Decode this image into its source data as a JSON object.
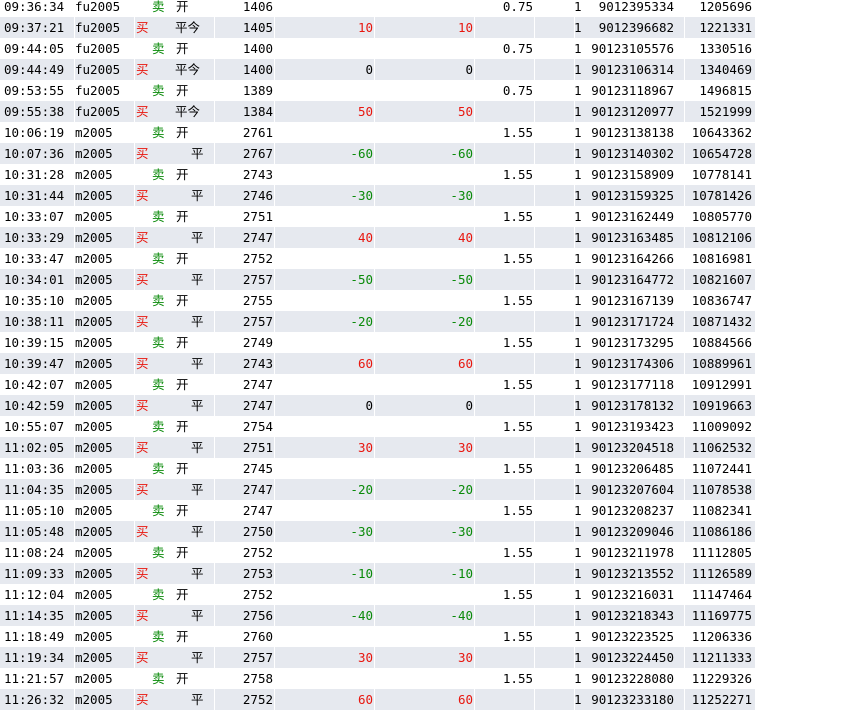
{
  "colors": {
    "buy": "#e8170f",
    "sell": "#0a8a0a",
    "row_alt": "#e6e9ef"
  },
  "rows": [
    {
      "time": "09:36:34",
      "symbol": "fu2005",
      "dir": "卖",
      "dir_type": "sell",
      "offset": "开",
      "offset_type": "open",
      "price": "1406",
      "pnl1": "",
      "pnl2": "",
      "fee": "0.75",
      "one": "1",
      "order_id": "9012395334",
      "trade_id": "1205696"
    },
    {
      "time": "09:37:21",
      "symbol": "fu2005",
      "dir": "买",
      "dir_type": "buy",
      "offset": "平今",
      "offset_type": "close2",
      "price": "1405",
      "pnl1": "10",
      "pnl2": "10",
      "fee": "",
      "one": "1",
      "order_id": "9012396682",
      "trade_id": "1221331"
    },
    {
      "time": "09:44:05",
      "symbol": "fu2005",
      "dir": "卖",
      "dir_type": "sell",
      "offset": "开",
      "offset_type": "open",
      "price": "1400",
      "pnl1": "",
      "pnl2": "",
      "fee": "0.75",
      "one": "1",
      "order_id": "90123105576",
      "trade_id": "1330516"
    },
    {
      "time": "09:44:49",
      "symbol": "fu2005",
      "dir": "买",
      "dir_type": "buy",
      "offset": "平今",
      "offset_type": "close2",
      "price": "1400",
      "pnl1": "0",
      "pnl2": "0",
      "fee": "",
      "one": "1",
      "order_id": "90123106314",
      "trade_id": "1340469"
    },
    {
      "time": "09:53:55",
      "symbol": "fu2005",
      "dir": "卖",
      "dir_type": "sell",
      "offset": "开",
      "offset_type": "open",
      "price": "1389",
      "pnl1": "",
      "pnl2": "",
      "fee": "0.75",
      "one": "1",
      "order_id": "90123118967",
      "trade_id": "1496815"
    },
    {
      "time": "09:55:38",
      "symbol": "fu2005",
      "dir": "买",
      "dir_type": "buy",
      "offset": "平今",
      "offset_type": "close2",
      "price": "1384",
      "pnl1": "50",
      "pnl2": "50",
      "fee": "",
      "one": "1",
      "order_id": "90123120977",
      "trade_id": "1521999"
    },
    {
      "time": "10:06:19",
      "symbol": "m2005",
      "dir": "卖",
      "dir_type": "sell",
      "offset": "开",
      "offset_type": "open",
      "price": "2761",
      "pnl1": "",
      "pnl2": "",
      "fee": "1.55",
      "one": "1",
      "order_id": "90123138138",
      "trade_id": "10643362"
    },
    {
      "time": "10:07:36",
      "symbol": "m2005",
      "dir": "买",
      "dir_type": "buy",
      "offset": "平",
      "offset_type": "close1",
      "price": "2767",
      "pnl1": "-60",
      "pnl2": "-60",
      "fee": "",
      "one": "1",
      "order_id": "90123140302",
      "trade_id": "10654728"
    },
    {
      "time": "10:31:28",
      "symbol": "m2005",
      "dir": "卖",
      "dir_type": "sell",
      "offset": "开",
      "offset_type": "open",
      "price": "2743",
      "pnl1": "",
      "pnl2": "",
      "fee": "1.55",
      "one": "1",
      "order_id": "90123158909",
      "trade_id": "10778141"
    },
    {
      "time": "10:31:44",
      "symbol": "m2005",
      "dir": "买",
      "dir_type": "buy",
      "offset": "平",
      "offset_type": "close1",
      "price": "2746",
      "pnl1": "-30",
      "pnl2": "-30",
      "fee": "",
      "one": "1",
      "order_id": "90123159325",
      "trade_id": "10781426"
    },
    {
      "time": "10:33:07",
      "symbol": "m2005",
      "dir": "卖",
      "dir_type": "sell",
      "offset": "开",
      "offset_type": "open",
      "price": "2751",
      "pnl1": "",
      "pnl2": "",
      "fee": "1.55",
      "one": "1",
      "order_id": "90123162449",
      "trade_id": "10805770"
    },
    {
      "time": "10:33:29",
      "symbol": "m2005",
      "dir": "买",
      "dir_type": "buy",
      "offset": "平",
      "offset_type": "close1",
      "price": "2747",
      "pnl1": "40",
      "pnl2": "40",
      "fee": "",
      "one": "1",
      "order_id": "90123163485",
      "trade_id": "10812106"
    },
    {
      "time": "10:33:47",
      "symbol": "m2005",
      "dir": "卖",
      "dir_type": "sell",
      "offset": "开",
      "offset_type": "open",
      "price": "2752",
      "pnl1": "",
      "pnl2": "",
      "fee": "1.55",
      "one": "1",
      "order_id": "90123164266",
      "trade_id": "10816981"
    },
    {
      "time": "10:34:01",
      "symbol": "m2005",
      "dir": "买",
      "dir_type": "buy",
      "offset": "平",
      "offset_type": "close1",
      "price": "2757",
      "pnl1": "-50",
      "pnl2": "-50",
      "fee": "",
      "one": "1",
      "order_id": "90123164772",
      "trade_id": "10821607"
    },
    {
      "time": "10:35:10",
      "symbol": "m2005",
      "dir": "卖",
      "dir_type": "sell",
      "offset": "开",
      "offset_type": "open",
      "price": "2755",
      "pnl1": "",
      "pnl2": "",
      "fee": "1.55",
      "one": "1",
      "order_id": "90123167139",
      "trade_id": "10836747"
    },
    {
      "time": "10:38:11",
      "symbol": "m2005",
      "dir": "买",
      "dir_type": "buy",
      "offset": "平",
      "offset_type": "close1",
      "price": "2757",
      "pnl1": "-20",
      "pnl2": "-20",
      "fee": "",
      "one": "1",
      "order_id": "90123171724",
      "trade_id": "10871432"
    },
    {
      "time": "10:39:15",
      "symbol": "m2005",
      "dir": "卖",
      "dir_type": "sell",
      "offset": "开",
      "offset_type": "open",
      "price": "2749",
      "pnl1": "",
      "pnl2": "",
      "fee": "1.55",
      "one": "1",
      "order_id": "90123173295",
      "trade_id": "10884566"
    },
    {
      "time": "10:39:47",
      "symbol": "m2005",
      "dir": "买",
      "dir_type": "buy",
      "offset": "平",
      "offset_type": "close1",
      "price": "2743",
      "pnl1": "60",
      "pnl2": "60",
      "fee": "",
      "one": "1",
      "order_id": "90123174306",
      "trade_id": "10889961"
    },
    {
      "time": "10:42:07",
      "symbol": "m2005",
      "dir": "卖",
      "dir_type": "sell",
      "offset": "开",
      "offset_type": "open",
      "price": "2747",
      "pnl1": "",
      "pnl2": "",
      "fee": "1.55",
      "one": "1",
      "order_id": "90123177118",
      "trade_id": "10912991"
    },
    {
      "time": "10:42:59",
      "symbol": "m2005",
      "dir": "买",
      "dir_type": "buy",
      "offset": "平",
      "offset_type": "close1",
      "price": "2747",
      "pnl1": "0",
      "pnl2": "0",
      "fee": "",
      "one": "1",
      "order_id": "90123178132",
      "trade_id": "10919663"
    },
    {
      "time": "10:55:07",
      "symbol": "m2005",
      "dir": "卖",
      "dir_type": "sell",
      "offset": "开",
      "offset_type": "open",
      "price": "2754",
      "pnl1": "",
      "pnl2": "",
      "fee": "1.55",
      "one": "1",
      "order_id": "90123193423",
      "trade_id": "11009092"
    },
    {
      "time": "11:02:05",
      "symbol": "m2005",
      "dir": "买",
      "dir_type": "buy",
      "offset": "平",
      "offset_type": "close1",
      "price": "2751",
      "pnl1": "30",
      "pnl2": "30",
      "fee": "",
      "one": "1",
      "order_id": "90123204518",
      "trade_id": "11062532"
    },
    {
      "time": "11:03:36",
      "symbol": "m2005",
      "dir": "卖",
      "dir_type": "sell",
      "offset": "开",
      "offset_type": "open",
      "price": "2745",
      "pnl1": "",
      "pnl2": "",
      "fee": "1.55",
      "one": "1",
      "order_id": "90123206485",
      "trade_id": "11072441"
    },
    {
      "time": "11:04:35",
      "symbol": "m2005",
      "dir": "买",
      "dir_type": "buy",
      "offset": "平",
      "offset_type": "close1",
      "price": "2747",
      "pnl1": "-20",
      "pnl2": "-20",
      "fee": "",
      "one": "1",
      "order_id": "90123207604",
      "trade_id": "11078538"
    },
    {
      "time": "11:05:10",
      "symbol": "m2005",
      "dir": "卖",
      "dir_type": "sell",
      "offset": "开",
      "offset_type": "open",
      "price": "2747",
      "pnl1": "",
      "pnl2": "",
      "fee": "1.55",
      "one": "1",
      "order_id": "90123208237",
      "trade_id": "11082341"
    },
    {
      "time": "11:05:48",
      "symbol": "m2005",
      "dir": "买",
      "dir_type": "buy",
      "offset": "平",
      "offset_type": "close1",
      "price": "2750",
      "pnl1": "-30",
      "pnl2": "-30",
      "fee": "",
      "one": "1",
      "order_id": "90123209046",
      "trade_id": "11086186"
    },
    {
      "time": "11:08:24",
      "symbol": "m2005",
      "dir": "卖",
      "dir_type": "sell",
      "offset": "开",
      "offset_type": "open",
      "price": "2752",
      "pnl1": "",
      "pnl2": "",
      "fee": "1.55",
      "one": "1",
      "order_id": "90123211978",
      "trade_id": "11112805"
    },
    {
      "time": "11:09:33",
      "symbol": "m2005",
      "dir": "买",
      "dir_type": "buy",
      "offset": "平",
      "offset_type": "close1",
      "price": "2753",
      "pnl1": "-10",
      "pnl2": "-10",
      "fee": "",
      "one": "1",
      "order_id": "90123213552",
      "trade_id": "11126589"
    },
    {
      "time": "11:12:04",
      "symbol": "m2005",
      "dir": "卖",
      "dir_type": "sell",
      "offset": "开",
      "offset_type": "open",
      "price": "2752",
      "pnl1": "",
      "pnl2": "",
      "fee": "1.55",
      "one": "1",
      "order_id": "90123216031",
      "trade_id": "11147464"
    },
    {
      "time": "11:14:35",
      "symbol": "m2005",
      "dir": "买",
      "dir_type": "buy",
      "offset": "平",
      "offset_type": "close1",
      "price": "2756",
      "pnl1": "-40",
      "pnl2": "-40",
      "fee": "",
      "one": "1",
      "order_id": "90123218343",
      "trade_id": "11169775"
    },
    {
      "time": "11:18:49",
      "symbol": "m2005",
      "dir": "卖",
      "dir_type": "sell",
      "offset": "开",
      "offset_type": "open",
      "price": "2760",
      "pnl1": "",
      "pnl2": "",
      "fee": "1.55",
      "one": "1",
      "order_id": "90123223525",
      "trade_id": "11206336"
    },
    {
      "time": "11:19:34",
      "symbol": "m2005",
      "dir": "买",
      "dir_type": "buy",
      "offset": "平",
      "offset_type": "close1",
      "price": "2757",
      "pnl1": "30",
      "pnl2": "30",
      "fee": "",
      "one": "1",
      "order_id": "90123224450",
      "trade_id": "11211333"
    },
    {
      "time": "11:21:57",
      "symbol": "m2005",
      "dir": "卖",
      "dir_type": "sell",
      "offset": "开",
      "offset_type": "open",
      "price": "2758",
      "pnl1": "",
      "pnl2": "",
      "fee": "1.55",
      "one": "1",
      "order_id": "90123228080",
      "trade_id": "11229326"
    },
    {
      "time": "11:26:32",
      "symbol": "m2005",
      "dir": "买",
      "dir_type": "buy",
      "offset": "平",
      "offset_type": "close1",
      "price": "2752",
      "pnl1": "60",
      "pnl2": "60",
      "fee": "",
      "one": "1",
      "order_id": "90123233180",
      "trade_id": "11252271"
    }
  ]
}
